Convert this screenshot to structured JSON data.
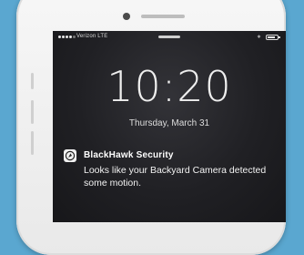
{
  "status_bar": {
    "carrier": "Verizon  LTE",
    "bluetooth": "∗",
    "battery_level": 0.8
  },
  "lock_screen": {
    "time": "10:20",
    "date": "Thursday, March 31"
  },
  "notification": {
    "app_icon": "camera-lens-icon",
    "app_name": "BlackHawk Security",
    "message": "Looks like your Backyard Camera detected some motion."
  },
  "colors": {
    "background": "#5aa7d0",
    "phone_body": "#f2f2f2",
    "screen": "#202024"
  }
}
